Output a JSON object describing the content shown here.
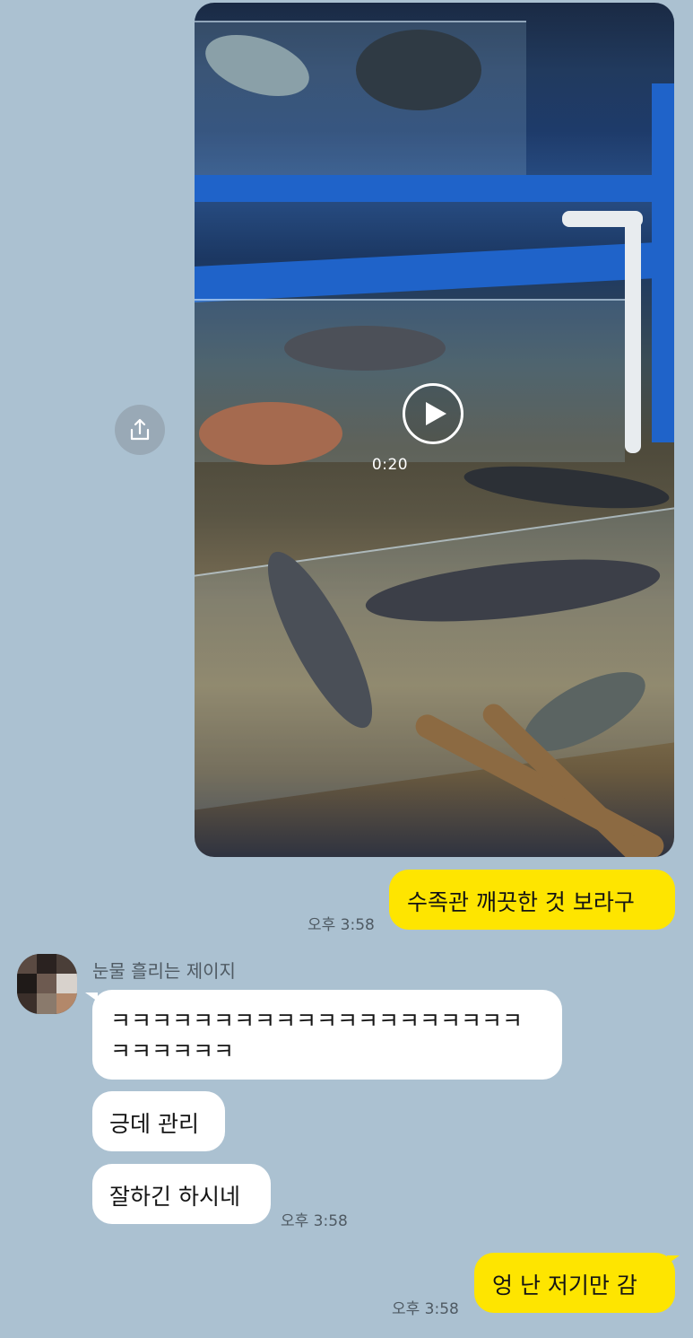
{
  "video": {
    "duration": "0:20"
  },
  "messages": {
    "m1": {
      "text": "수족관 깨끗한 것 보라구",
      "time": "오후 3:58"
    },
    "sender": {
      "name": "눈물 흘리는 제이지"
    },
    "m2": {
      "line1": "ㅋㅋㅋㅋㅋㅋㅋㅋㅋㅋㅋㅋㅋㅋㅋㅋㅋㅋㅋㅋ",
      "line2": "ㅋㅋㅋㅋㅋㅋ"
    },
    "m3": {
      "text": "긍데 관리"
    },
    "m4": {
      "text": "잘하긴 하시네",
      "time": "오후 3:58"
    },
    "m5": {
      "text": "엉 난 저기만 감",
      "time": "오후 3:58"
    }
  },
  "colors": {
    "background": "#abc1d1",
    "outgoing_bubble": "#fee500",
    "incoming_bubble": "#ffffff"
  },
  "icons": {
    "share": "share-icon",
    "play": "play-icon"
  }
}
